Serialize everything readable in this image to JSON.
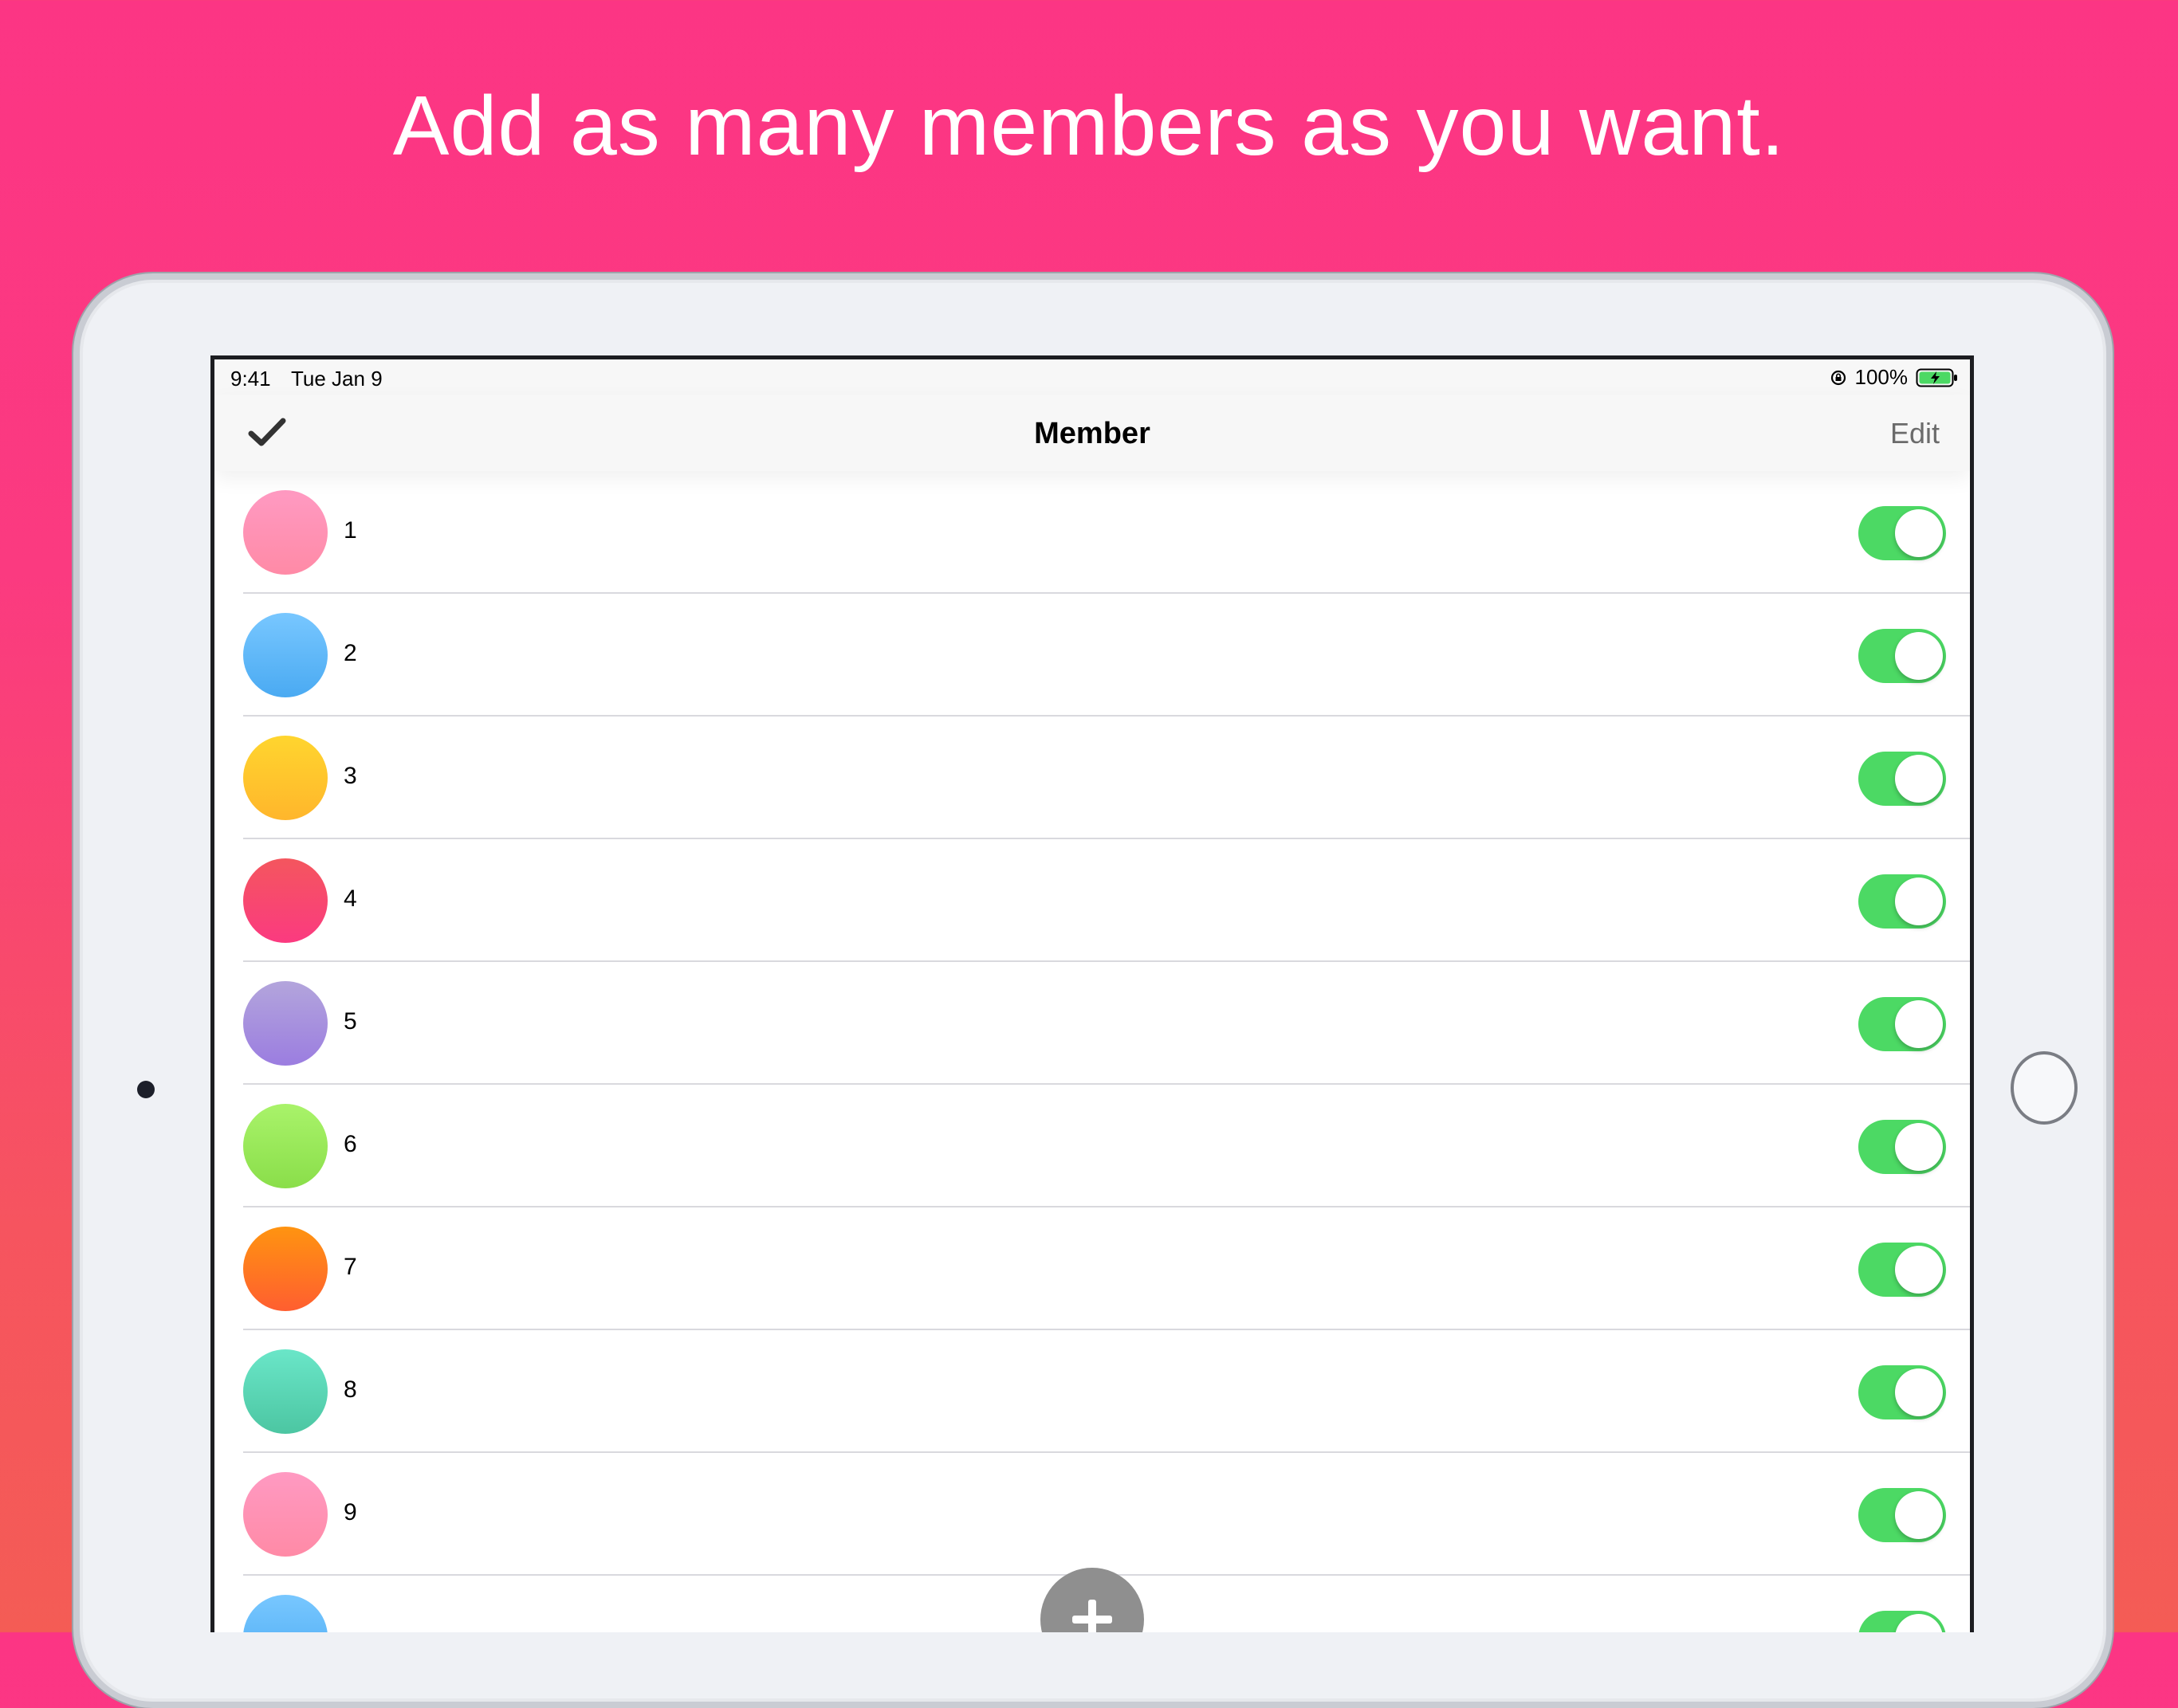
{
  "headline": "Add as many members as you want.",
  "statusbar": {
    "time": "9:41",
    "date": "Tue Jan 9",
    "battery_percent": "100%",
    "battery_icon": "battery-charging-icon",
    "lock_icon": "rotation-lock-icon"
  },
  "navbar": {
    "left_icon": "checkmark-icon",
    "title": "Member",
    "edit_label": "Edit"
  },
  "members": [
    {
      "label": "1",
      "color_top": "#ff9ac2",
      "color_bottom": "#ff8aa6",
      "enabled": true
    },
    {
      "label": "2",
      "color_top": "#78c7ff",
      "color_bottom": "#4aaaf2",
      "enabled": true
    },
    {
      "label": "3",
      "color_top": "#ffd52e",
      "color_bottom": "#ffb62c",
      "enabled": true
    },
    {
      "label": "4",
      "color_top": "#f4565e",
      "color_bottom": "#fb3a80",
      "enabled": true
    },
    {
      "label": "5",
      "color_top": "#b3a5dc",
      "color_bottom": "#9b7de0",
      "enabled": true
    },
    {
      "label": "6",
      "color_top": "#a9f36a",
      "color_bottom": "#8ade4a",
      "enabled": true
    },
    {
      "label": "7",
      "color_top": "#ff9410",
      "color_bottom": "#ff5e30",
      "enabled": true
    },
    {
      "label": "8",
      "color_top": "#6ae6c8",
      "color_bottom": "#4cc6a2",
      "enabled": true
    },
    {
      "label": "9",
      "color_top": "#ff9ac2",
      "color_bottom": "#ff8aa6",
      "enabled": true
    },
    {
      "label": "",
      "color_top": "#78c7ff",
      "color_bottom": "#4aaaf2",
      "enabled": true
    }
  ],
  "add_button_icon": "plus-icon",
  "colors": {
    "background_top": "#fc3584",
    "background_bottom": "#f45c55",
    "toggle_on": "#4cd964"
  }
}
